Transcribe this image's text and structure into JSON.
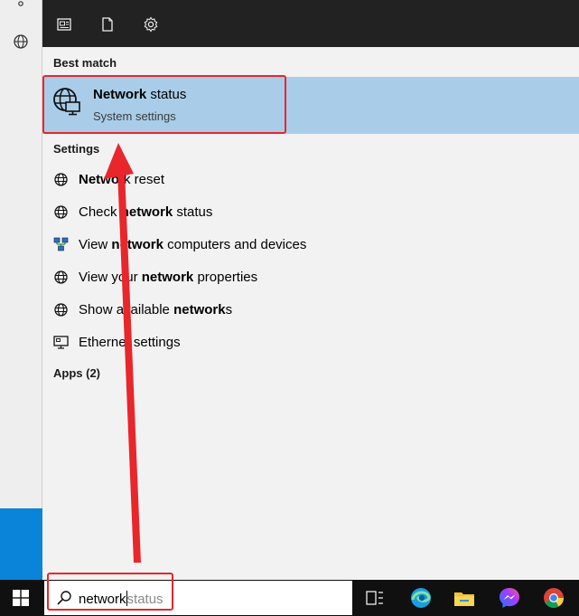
{
  "left_rail": {
    "icons": [
      "small-icon",
      "globe-icon"
    ]
  },
  "header": {
    "icons": [
      "news-icon",
      "document-icon",
      "settings-gear-icon"
    ]
  },
  "best_match": {
    "section": "Best match",
    "title_bold": "Network",
    "title_rest": " status",
    "subtitle": "System settings",
    "icon": "network-globe-monitor-icon"
  },
  "settings_section": "Settings",
  "results": [
    {
      "pre": "",
      "bold": "Netwo",
      "post": "rk reset",
      "icon": "globe-icon"
    },
    {
      "pre": "Check ",
      "bold": "network",
      "post": " status",
      "icon": "globe-icon"
    },
    {
      "pre": "View ",
      "bold": "network",
      "post": " computers and devices",
      "icon": "network-computers-icon"
    },
    {
      "pre": "View your ",
      "bold": "network",
      "post": " properties",
      "icon": "globe-icon"
    },
    {
      "pre": "Show available ",
      "bold": "network",
      "post": "s",
      "icon": "globe-icon"
    },
    {
      "pre": "Ethernet settings",
      "bold": "",
      "post": "",
      "icon": "ethernet-monitor-icon"
    }
  ],
  "apps_section": "Apps (2)",
  "taskbar": {
    "search_typed": "network",
    "search_autocomplete": "status",
    "apps": [
      "task-view-icon",
      "edge-icon",
      "file-explorer-icon",
      "messenger-icon",
      "chrome-icon"
    ]
  },
  "colors": {
    "highlight": "#a9cde8",
    "annotation": "#e8262b",
    "taskbar": "#101010",
    "panel_header": "#222222"
  }
}
